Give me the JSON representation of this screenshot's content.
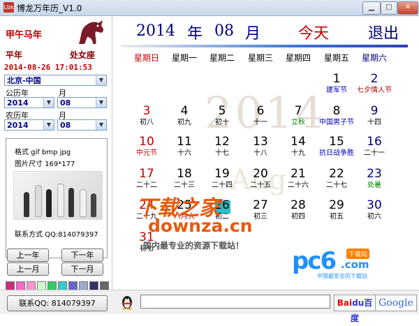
{
  "window": {
    "icon_text": "Lbk",
    "title": "博龙万年历_V1.0"
  },
  "left": {
    "ganzhi": "甲午马年",
    "leap_status": "平年",
    "star_sign": "处女座",
    "datetime": "2014-08-26 17:01:53",
    "city": "北京-中国",
    "solar_label": "公历年",
    "solar_year": "2014",
    "solar_month_label": "月",
    "solar_month": "08",
    "lunar_label": "农历年",
    "lunar_year": "2014",
    "lunar_month_label": "月",
    "lunar_month": "08",
    "info_format": "格式    gif bmp jpg",
    "info_size": "图片尺寸  169*177",
    "info_contact": "联系方式 QQ:814079397",
    "prev_year": "上一年",
    "next_year": "下一年",
    "prev_month": "上一月",
    "next_month": "下一月",
    "swatches": [
      "#c8327a",
      "#ff66cc",
      "#ff99cc",
      "#ccffcc",
      "#33cc66",
      "#33cccc",
      "#6666cc",
      "#99aacc",
      "#333366",
      "#666666"
    ]
  },
  "header": {
    "year": "2014",
    "year_char": "年",
    "month": "08",
    "month_char": "月",
    "today": "今天",
    "exit": "退出"
  },
  "weekdays": [
    "星期日",
    "星期一",
    "星期二",
    "星期三",
    "星期四",
    "星期五",
    "星期六"
  ],
  "watermark": {
    "year": "2014",
    "month": "Aug"
  },
  "days": [
    {
      "n": "1",
      "s": "建军节"
    },
    {
      "n": "2",
      "s": "七夕情人节"
    },
    {
      "n": "3",
      "s": "初八"
    },
    {
      "n": "4",
      "s": "初九"
    },
    {
      "n": "5",
      "s": "初十"
    },
    {
      "n": "6",
      "s": "十一"
    },
    {
      "n": "7",
      "s": "立秋"
    },
    {
      "n": "8",
      "s": "中国男子节"
    },
    {
      "n": "9",
      "s": "十四"
    },
    {
      "n": "10",
      "s": "中元节"
    },
    {
      "n": "11",
      "s": "十六"
    },
    {
      "n": "12",
      "s": "十七"
    },
    {
      "n": "13",
      "s": "十八"
    },
    {
      "n": "14",
      "s": "十九"
    },
    {
      "n": "15",
      "s": "抗日战争胜"
    },
    {
      "n": "16",
      "s": "二十一"
    },
    {
      "n": "17",
      "s": "二十二"
    },
    {
      "n": "18",
      "s": "二十三"
    },
    {
      "n": "19",
      "s": "二十四"
    },
    {
      "n": "20",
      "s": "二十五"
    },
    {
      "n": "21",
      "s": "二十六"
    },
    {
      "n": "22",
      "s": "二十七"
    },
    {
      "n": "23",
      "s": "处暑"
    },
    {
      "n": "24",
      "s": "二十九"
    },
    {
      "n": "25",
      "s": "八月大"
    },
    {
      "n": "26",
      "s": "初二"
    },
    {
      "n": "27",
      "s": "初三"
    },
    {
      "n": "28",
      "s": "初四"
    },
    {
      "n": "29",
      "s": "初五"
    },
    {
      "n": "30",
      "s": "初六"
    },
    {
      "n": "31",
      "s": "初七"
    }
  ],
  "site_watermark": {
    "cn": "下载之家",
    "url": "downza.cn",
    "slogan": "国内最专业的资源下载站！"
  },
  "pc6": {
    "main": "pc6",
    "com": ".com",
    "badge": "下载站",
    "slogan": "中国最安全的下载站"
  },
  "bottom": {
    "contact": "联系QQ: 814079397",
    "baidu_a": "Bai",
    "baidu_b": "du百度",
    "google": "Google"
  }
}
